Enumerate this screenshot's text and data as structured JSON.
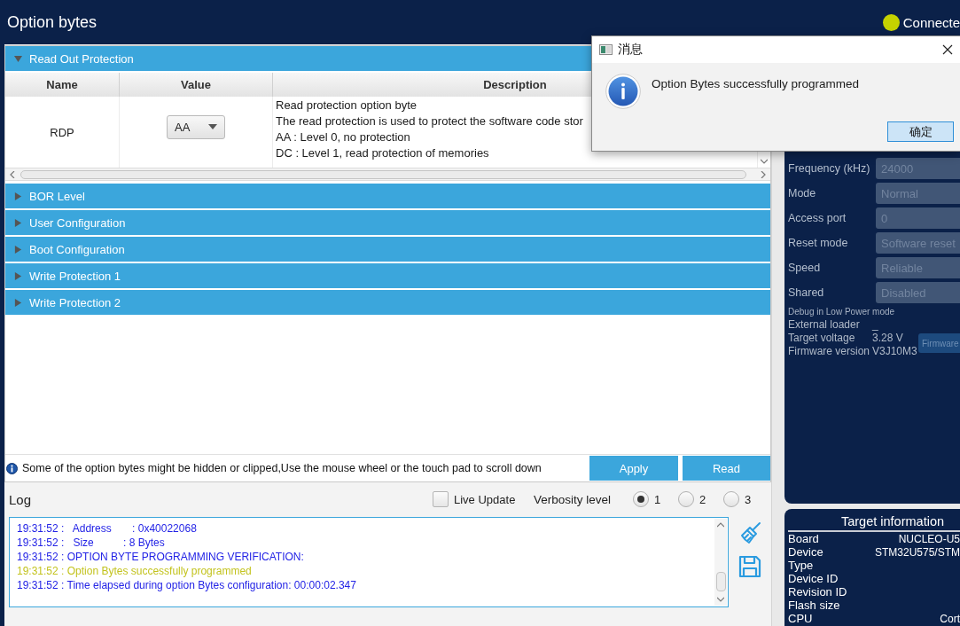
{
  "window": {
    "title": "Option bytes"
  },
  "status": {
    "label": "Connecte",
    "connected": true
  },
  "sections": [
    {
      "title": "Read Out Protection",
      "expanded": true,
      "table": {
        "columns": [
          "Name",
          "Value",
          "Description"
        ],
        "rows": [
          {
            "name": "RDP",
            "value": "AA",
            "description": [
              "Read protection option byte",
              "The read protection is used to protect the software code stor",
              "AA : Level 0, no protection",
              "DC : Level 1, read protection of memories"
            ]
          }
        ]
      }
    },
    {
      "title": "BOR Level",
      "expanded": false
    },
    {
      "title": "User Configuration",
      "expanded": false
    },
    {
      "title": "Boot Configuration",
      "expanded": false
    },
    {
      "title": "Write Protection 1",
      "expanded": false
    },
    {
      "title": "Write Protection 2",
      "expanded": false
    }
  ],
  "notice": "Some of the option bytes might be hidden or clipped,Use the mouse wheel or the touch pad to scroll down",
  "actions": [
    "Apply",
    "Read"
  ],
  "log": {
    "title": "Log",
    "live_update": {
      "label": "Live Update",
      "checked": false
    },
    "verbosity": {
      "label": "Verbosity level",
      "options": [
        {
          "label": "1",
          "selected": true
        },
        {
          "label": "2",
          "selected": false
        },
        {
          "label": "3",
          "selected": false
        }
      ]
    },
    "lines": [
      {
        "text": "19:31:52 :   Address       : 0x40022068",
        "color": "#2323e6"
      },
      {
        "text": "19:31:52 :   Size          : 8 Bytes",
        "color": "#2323e6"
      },
      {
        "text": "19:31:52 : OPTION BYTE PROGRAMMING VERIFICATION:",
        "color": "#2323e6"
      },
      {
        "text": "19:31:52 : Option Bytes successfully programmed",
        "color": "#c3c31e"
      },
      {
        "text": "19:31:52 : Time elapsed during option Bytes configuration: 00:00:02.347",
        "color": "#2323e6"
      }
    ]
  },
  "connection_settings": [
    {
      "label": "Frequency (kHz)",
      "value": "24000",
      "disabled": true
    },
    {
      "label": "Mode",
      "value": "Normal",
      "disabled": true
    },
    {
      "label": "Access port",
      "value": "0",
      "disabled": true
    },
    {
      "label": "Reset mode",
      "value": "Software reset",
      "disabled": true
    },
    {
      "label": "Speed",
      "value": "Reliable",
      "disabled": true
    },
    {
      "label": "Shared",
      "value": "Disabled",
      "disabled": true
    }
  ],
  "debug_note": "Debug in Low Power mode",
  "probe_info": [
    {
      "label": "External loader",
      "reading": "_"
    },
    {
      "label": "Target voltage",
      "reading": "3.28 V"
    },
    {
      "label": "Firmware version",
      "reading": "V3J10M3"
    }
  ],
  "firmware_button": {
    "label": "Firmware",
    "disabled": true
  },
  "target_information": {
    "title": "Target information",
    "rows": [
      {
        "label": "Board",
        "value": "NUCLEO-U5"
      },
      {
        "label": "Device",
        "value": "STM32U575/STM"
      },
      {
        "label": "Type"
      },
      {
        "label": "Device ID"
      },
      {
        "label": "Revision ID"
      },
      {
        "label": "Flash size"
      },
      {
        "label": "CPU",
        "value": "Cort"
      }
    ]
  },
  "dialog": {
    "title": "消息",
    "message": "Option Bytes successfully programmed",
    "button": "确定"
  }
}
